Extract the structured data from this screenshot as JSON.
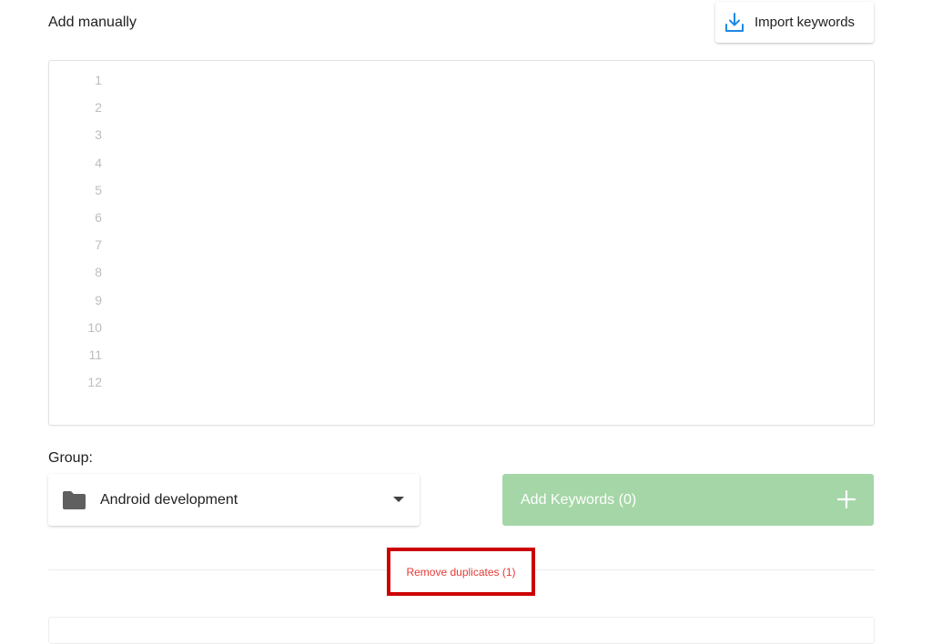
{
  "add_manually": {
    "title": "Add manually",
    "import_button": {
      "label": "Import keywords",
      "icon": "download-tray-icon"
    }
  },
  "editor": {
    "line_numbers": [
      "1",
      "2",
      "3",
      "4",
      "5",
      "6",
      "7",
      "8",
      "9",
      "10",
      "11",
      "12"
    ],
    "content": ""
  },
  "group": {
    "label": "Group:",
    "selected": "Android development",
    "icon": "folder-icon"
  },
  "add_keywords": {
    "label": "Add Keywords (0)",
    "icon": "plus-icon"
  },
  "remove_duplicates": {
    "label": "Remove duplicates (1)"
  },
  "colors": {
    "accent_blue": "#1e88e5",
    "add_button_green": "#a5d6a7",
    "danger_red": "#e53935",
    "highlight_box": "#cc0000"
  }
}
